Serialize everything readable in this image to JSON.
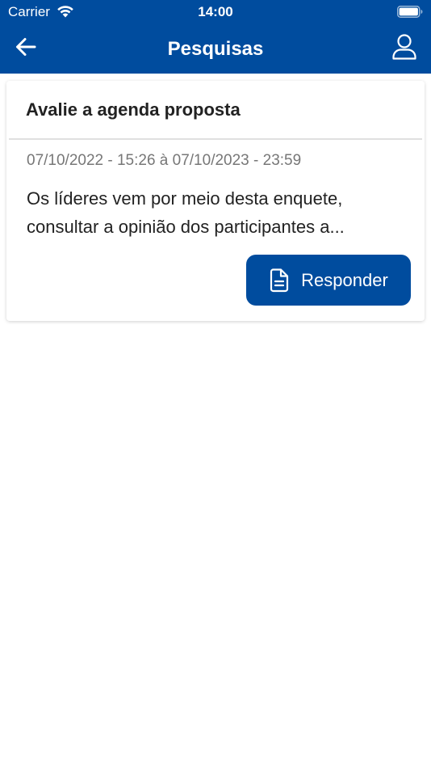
{
  "status_bar": {
    "carrier": "Carrier",
    "time": "14:00",
    "wifi_icon": "wifi-icon",
    "battery_icon": "battery-icon"
  },
  "header": {
    "title": "Pesquisas",
    "back_icon": "arrow-left-icon",
    "profile_icon": "user-icon"
  },
  "survey_card": {
    "title": "Avalie a agenda proposta",
    "dates": "07/10/2022 - 15:26 à 07/10/2023 - 23:59",
    "description": "Os líderes vem por meio desta enquete, consultar a opinião dos participantes a...",
    "respond_button": {
      "label": "Responder",
      "icon": "document-icon"
    }
  },
  "colors": {
    "primary": "#004c9e",
    "text_dark": "#222222",
    "text_muted": "#777777",
    "background": "#ffffff"
  }
}
